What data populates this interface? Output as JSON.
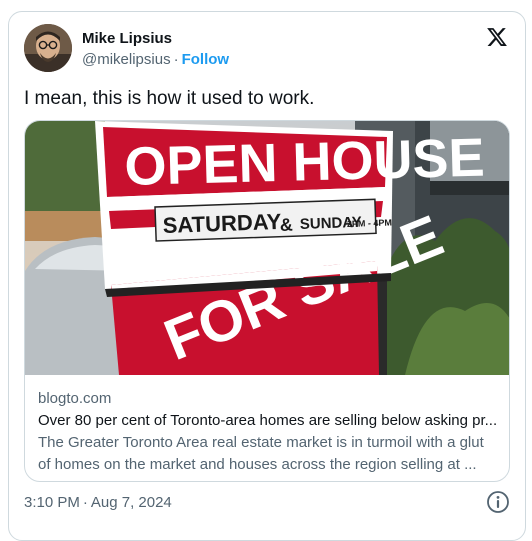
{
  "author": {
    "name": "Mike Lipsius",
    "handle": "@mikelipsius",
    "separator": "·",
    "follow_label": "Follow"
  },
  "tweet": {
    "text": "I mean, this is how it used to work."
  },
  "link_card": {
    "image_sign": {
      "line1": "OPEN HOUSE",
      "day1": "SATURDAY",
      "amp": "&",
      "day2": "SUNDAY",
      "time": "2PM - 4PM",
      "rider": "FOR SALE"
    },
    "domain": "blogto.com",
    "headline": "Over 80 per cent of Toronto-area homes are selling below asking pr...",
    "description_line1": "The Greater Toronto Area real estate market is in turmoil with a glut",
    "description_line2": "of homes on the market and houses across the region selling at ..."
  },
  "meta": {
    "time": "3:10 PM",
    "separator": "·",
    "date": "Aug 7, 2024"
  },
  "icons": {
    "logo": "x-logo-icon",
    "info": "info-icon",
    "avatar": "avatar"
  },
  "colors": {
    "accent": "#1d9bf0",
    "text": "#0f1419",
    "secondary": "#536471",
    "border": "#cfd9de",
    "sign_red": "#c8102e"
  }
}
